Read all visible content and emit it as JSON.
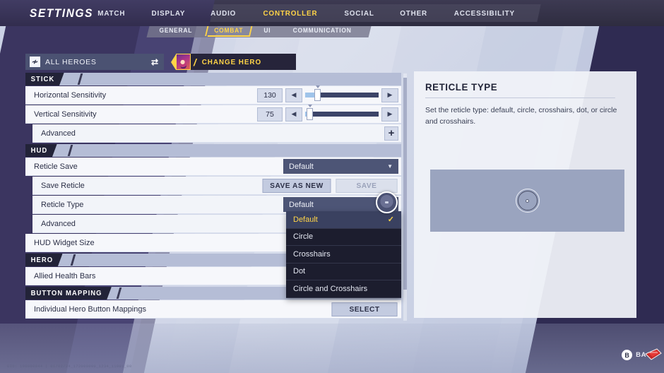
{
  "header": {
    "title": "SETTINGS",
    "tabs": [
      {
        "label": "MATCH",
        "active": false
      },
      {
        "label": "DISPLAY",
        "active": false
      },
      {
        "label": "AUDIO",
        "active": false
      },
      {
        "label": "CONTROLLER",
        "active": true
      },
      {
        "label": "SOCIAL",
        "active": false
      },
      {
        "label": "OTHER",
        "active": false
      },
      {
        "label": "ACCESSIBILITY",
        "active": false
      }
    ],
    "subtabs": [
      {
        "label": "GENERAL",
        "active": false
      },
      {
        "label": "COMBAT",
        "active": true
      },
      {
        "label": "UI",
        "active": false
      },
      {
        "label": "COMMUNICATION",
        "active": false
      }
    ],
    "accent_color": "#ffd447"
  },
  "hero_selector": {
    "icon": "hero-roster-icon",
    "label": "ALL HEROES",
    "swap_icon": "swap-arrows-icon",
    "change_hero_label": "CHANGE HERO",
    "portrait": "hero-portrait"
  },
  "sections": {
    "stick": {
      "title": "STICK",
      "rows": {
        "horizontal": {
          "label": "Horizontal Sensitivity",
          "value": "130",
          "fill_pct": 13,
          "knob_pct": 13
        },
        "vertical": {
          "label": "Vertical Sensitivity",
          "value": "75",
          "fill_pct": 2,
          "knob_pct": 2
        },
        "advanced": {
          "label": "Advanced",
          "expand_icon": "plus-icon"
        }
      }
    },
    "hud": {
      "title": "HUD",
      "rows": {
        "reticle_save": {
          "label": "Reticle Save",
          "value": "Default"
        },
        "save_reticle": {
          "label": "Save Reticle",
          "save_as_new_label": "SAVE AS NEW",
          "save_label": "SAVE",
          "save_disabled": true
        },
        "reticle_type": {
          "label": "Reticle Type",
          "value": "Default"
        },
        "advanced": {
          "label": "Advanced"
        },
        "hud_widget_size": {
          "label": "HUD Widget Size"
        }
      }
    },
    "hero": {
      "title": "HERO",
      "rows": {
        "allied_health_bars": {
          "label": "Allied Health Bars"
        }
      }
    },
    "button_mapping": {
      "title": "BUTTON MAPPING",
      "rows": {
        "individual": {
          "label": "Individual Hero Button Mappings",
          "button_label": "SELECT"
        }
      }
    }
  },
  "reticle_type_dropdown": {
    "open": true,
    "options": [
      {
        "label": "Default",
        "selected": true
      },
      {
        "label": "Circle",
        "selected": false
      },
      {
        "label": "Crosshairs",
        "selected": false
      },
      {
        "label": "Dot",
        "selected": false
      },
      {
        "label": "Circle and Crosshairs",
        "selected": false
      }
    ],
    "check_icon": "check-icon"
  },
  "info_panel": {
    "title": "RETICLE TYPE",
    "description": "Set the reticle type: default, circle, crosshairs, dot, or circle and crosshairs.",
    "preview": "reticle-preview-default"
  },
  "footer": {
    "build_text": "UID: 100000944 | 01/02/24_172000000_1234_11001_00",
    "back_button_glyph": "B",
    "back_label": "BACK",
    "cursor_icon": "hand-cursor-icon"
  }
}
